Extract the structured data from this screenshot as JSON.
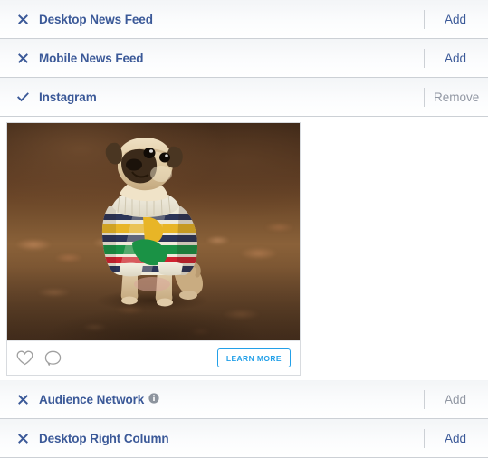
{
  "panel": {
    "name": "placements-panel",
    "accent_blue": "#3b5998",
    "disabled_grey": "#9197a3",
    "cta_blue": "#23a0e8"
  },
  "rows_top": [
    {
      "label": "Desktop News Feed",
      "icon": "close-icon",
      "state": "collapsed",
      "action_label": "Add",
      "action_enabled": true
    },
    {
      "label": "Mobile News Feed",
      "icon": "close-icon",
      "state": "collapsed",
      "action_label": "Add",
      "action_enabled": true
    },
    {
      "label": "Instagram",
      "icon": "check-icon",
      "state": "expanded",
      "action_label": "Remove",
      "action_enabled": false
    }
  ],
  "rows_bottom": [
    {
      "label": "Audience Network",
      "icon": "close-icon",
      "state": "collapsed",
      "has_info_icon": true,
      "info_icon": "info-icon",
      "action_label": "Add",
      "action_enabled": false
    },
    {
      "label": "Desktop Right Column",
      "icon": "close-icon",
      "state": "collapsed",
      "has_info_icon": false,
      "action_label": "Add",
      "action_enabled": true
    }
  ],
  "preview": {
    "name": "instagram-ad-preview",
    "photo_alt": "pug dog wearing a striped sweater sitting on autumn leaves",
    "like_icon": "heart-icon",
    "comment_icon": "comment-bubble-icon",
    "cta_label": "LEARN MORE"
  }
}
